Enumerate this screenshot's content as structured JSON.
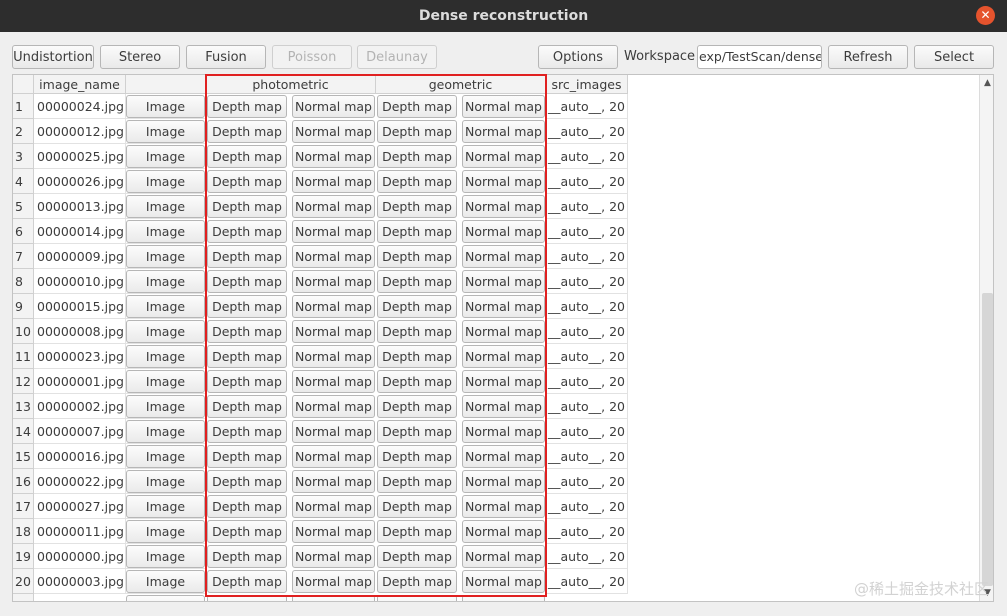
{
  "window": {
    "title": "Dense reconstruction",
    "close_glyph": "✕"
  },
  "toolbar": {
    "undistortion": "Undistortion",
    "stereo": "Stereo",
    "fusion": "Fusion",
    "poisson": "Poisson",
    "delaunay": "Delaunay",
    "options": "Options",
    "workspace_label": "Workspace",
    "workspace_value": "exp/TestScan/dense",
    "refresh": "Refresh",
    "select": "Select"
  },
  "table": {
    "headers": {
      "image_name": "image_name",
      "image_btn": "",
      "photometric": "photometric",
      "geometric": "geometric",
      "src_images": "src_images"
    },
    "button_labels": {
      "image": "Image",
      "depth": "Depth map",
      "normal": "Normal map"
    },
    "rows": [
      {
        "num": "1",
        "name": "00000024.jpg",
        "src": "__auto__, 20"
      },
      {
        "num": "2",
        "name": "00000012.jpg",
        "src": "__auto__, 20"
      },
      {
        "num": "3",
        "name": "00000025.jpg",
        "src": "__auto__, 20"
      },
      {
        "num": "4",
        "name": "00000026.jpg",
        "src": "__auto__, 20"
      },
      {
        "num": "5",
        "name": "00000013.jpg",
        "src": "__auto__, 20"
      },
      {
        "num": "6",
        "name": "00000014.jpg",
        "src": "__auto__, 20"
      },
      {
        "num": "7",
        "name": "00000009.jpg",
        "src": "__auto__, 20"
      },
      {
        "num": "8",
        "name": "00000010.jpg",
        "src": "__auto__, 20"
      },
      {
        "num": "9",
        "name": "00000015.jpg",
        "src": "__auto__, 20"
      },
      {
        "num": "10",
        "name": "00000008.jpg",
        "src": "__auto__, 20"
      },
      {
        "num": "11",
        "name": "00000023.jpg",
        "src": "__auto__, 20"
      },
      {
        "num": "12",
        "name": "00000001.jpg",
        "src": "__auto__, 20"
      },
      {
        "num": "13",
        "name": "00000002.jpg",
        "src": "__auto__, 20"
      },
      {
        "num": "14",
        "name": "00000007.jpg",
        "src": "__auto__, 20"
      },
      {
        "num": "15",
        "name": "00000016.jpg",
        "src": "__auto__, 20"
      },
      {
        "num": "16",
        "name": "00000022.jpg",
        "src": "__auto__, 20"
      },
      {
        "num": "17",
        "name": "00000027.jpg",
        "src": "__auto__, 20"
      },
      {
        "num": "18",
        "name": "00000011.jpg",
        "src": "__auto__, 20"
      },
      {
        "num": "19",
        "name": "00000000.jpg",
        "src": "__auto__, 20"
      },
      {
        "num": "20",
        "name": "00000003.jpg",
        "src": "__auto__, 20"
      }
    ]
  },
  "scrollbar": {
    "up_glyph": "▲",
    "down_glyph": "▼"
  },
  "watermark": "@稀土掘金技术社区",
  "colors": {
    "highlight": "#e02020",
    "titlebar": "#2d2d2d",
    "close": "#e5532d"
  }
}
